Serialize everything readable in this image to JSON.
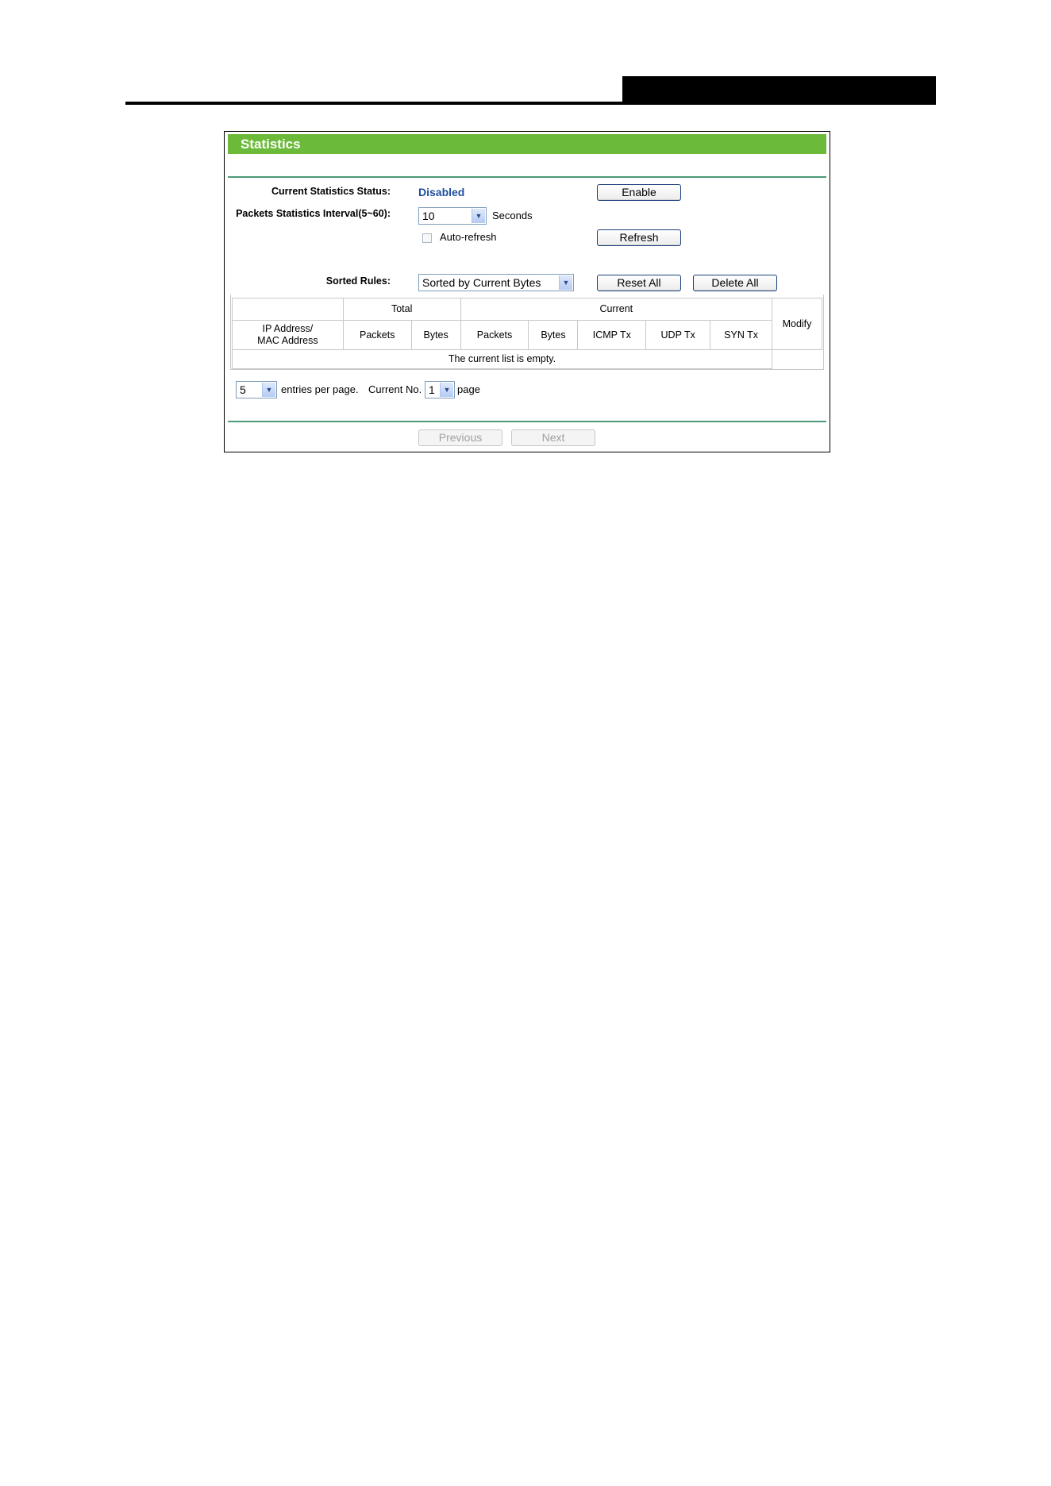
{
  "panel": {
    "title": "Statistics",
    "status_label": "Current Statistics Status:",
    "status_value": "Disabled",
    "enable_button": "Enable",
    "interval_label": "Packets Statistics Interval(5~60):",
    "interval_value": "10",
    "interval_unit": "Seconds",
    "autorefresh_label": "Auto-refresh",
    "autorefresh_checked": false,
    "refresh_button": "Refresh",
    "sorted_label": "Sorted Rules:",
    "sorted_value": "Sorted by Current Bytes",
    "reset_all_button": "Reset All",
    "delete_all_button": "Delete All"
  },
  "table": {
    "group_total": "Total",
    "group_current": "Current",
    "col_ip_line1": "IP Address/",
    "col_ip_line2": "MAC Address",
    "col_total_packets": "Packets",
    "col_total_bytes": "Bytes",
    "col_current_packets": "Packets",
    "col_current_bytes": "Bytes",
    "col_icmp": "ICMP Tx",
    "col_udp": "UDP Tx",
    "col_syn": "SYN Tx",
    "col_modify": "Modify",
    "empty_message": "The current list is empty."
  },
  "pagination": {
    "entries_value": "5",
    "entries_label": "entries per page.",
    "current_label": "Current No.",
    "page_value": "1",
    "page_label": "page",
    "previous_button": "Previous",
    "next_button": "Next"
  },
  "colors": {
    "title_bar": "#6cba39",
    "separator": "#4c9a78",
    "status_text": "#1f4f9e"
  }
}
